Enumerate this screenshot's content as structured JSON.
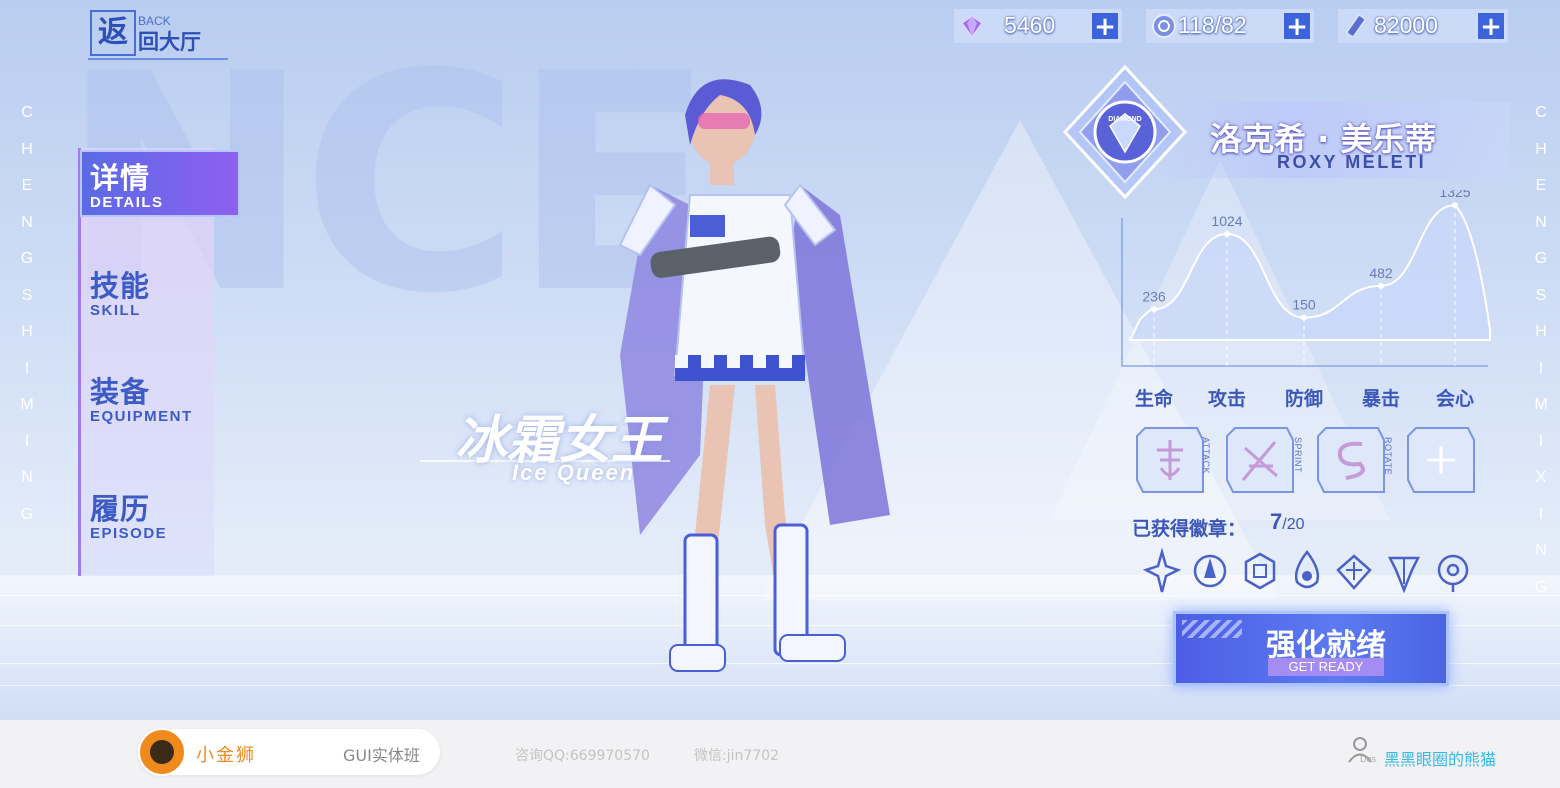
{
  "back": {
    "glyph": "返",
    "en": "BACK",
    "cn": "回大厅"
  },
  "currency": [
    {
      "icon": "diamond-icon",
      "value": "5460"
    },
    {
      "icon": "coin-icon",
      "value": "118/82"
    },
    {
      "icon": "crystal-icon",
      "value": "82000"
    }
  ],
  "side_text": {
    "left": "CHENGSHIMING",
    "right": "CHENGSHIMIXING"
  },
  "nav": [
    {
      "cn": "详情",
      "en": "DETAILS",
      "active": true
    },
    {
      "cn": "技能",
      "en": "SKILL",
      "active": false
    },
    {
      "cn": "装备",
      "en": "EQUIPMENT",
      "active": false
    },
    {
      "cn": "履历",
      "en": "EPISODE",
      "active": false
    }
  ],
  "character": {
    "title_cn": "冰霜女王",
    "title_en": "Ice Queen",
    "name_cn": "洛克希 · 美乐蒂",
    "name_en": "ROXY MELETI",
    "rank": "DIAMOND"
  },
  "chart_data": {
    "type": "area",
    "categories": [
      "生命",
      "攻击",
      "防御",
      "暴击",
      "会心"
    ],
    "values": [
      236,
      1024,
      150,
      482,
      1325
    ],
    "value_labels": [
      "236",
      "1024",
      "150",
      "482",
      "1325"
    ]
  },
  "skills": [
    {
      "tag": "ATTACK",
      "icon": "attack-skill-icon"
    },
    {
      "tag": "SPRINT",
      "icon": "sprint-skill-icon"
    },
    {
      "tag": "ROTATE",
      "icon": "rotate-skill-icon"
    },
    {
      "tag": "",
      "icon": "add-skill-icon"
    }
  ],
  "badges": {
    "label": "已获得徽章：",
    "count": "7",
    "total": "/20"
  },
  "ready": {
    "cn": "强化就绪",
    "en": "GET READY"
  },
  "footer": {
    "brand": "小金狮",
    "course": "GUI实体班",
    "qq": "咨询QQ:669970570",
    "wechat": "微信:jin7702",
    "des": "Des",
    "author": "黑黑眼圈的熊猫"
  },
  "colors": {
    "primary": "#3c57b8",
    "accent": "#5c7af0",
    "violet": "#9f7af0",
    "brand": "#ee8a1e",
    "author": "#35b8e8"
  }
}
